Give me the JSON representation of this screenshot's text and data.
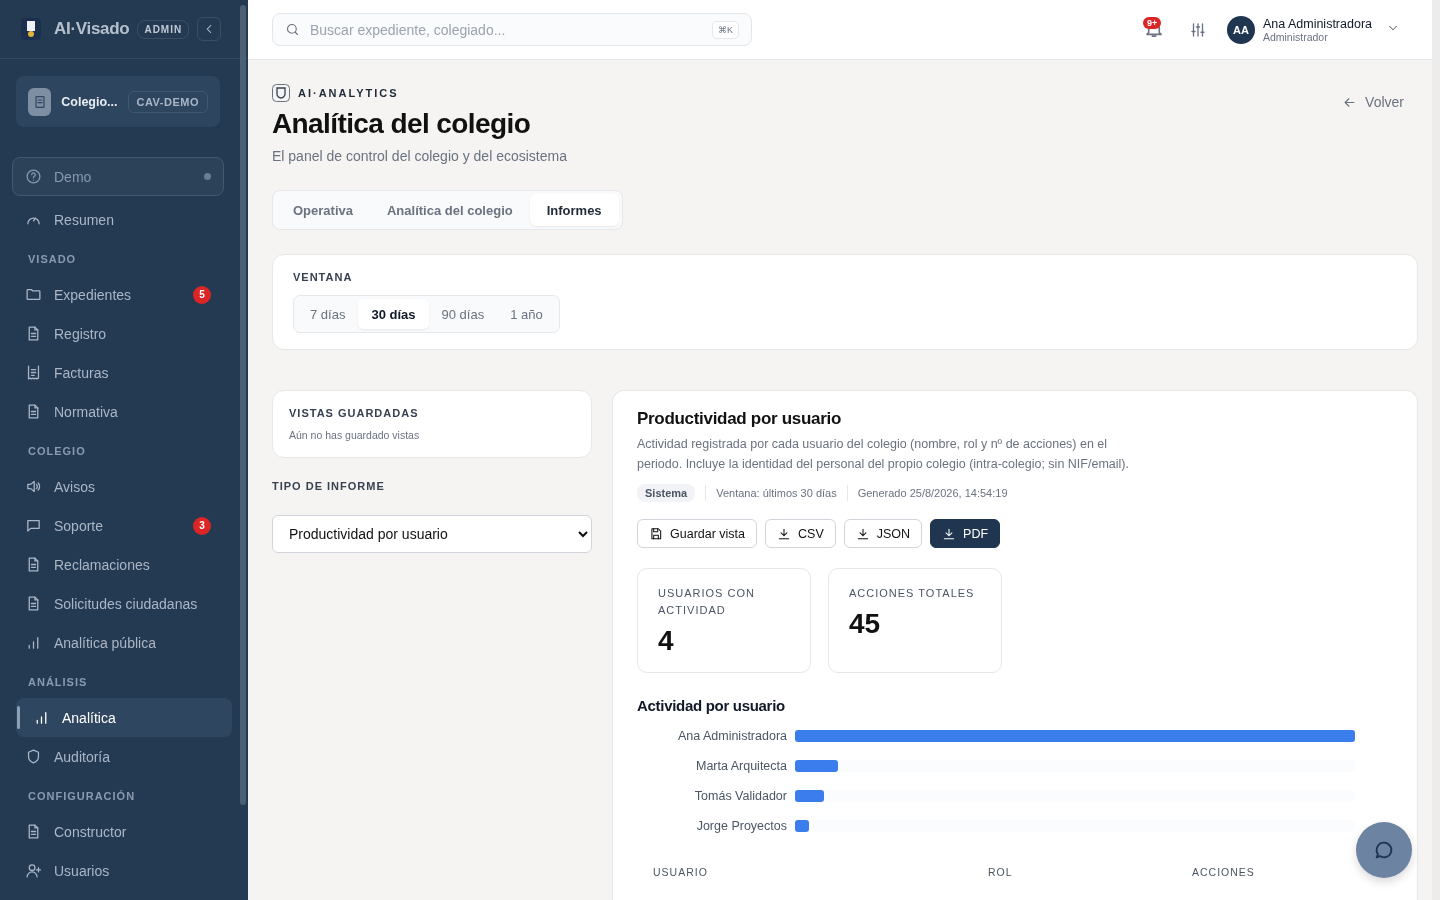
{
  "brand": {
    "name": "AI·Visado",
    "role_badge": "ADMIN"
  },
  "org": {
    "name": "Colegio...",
    "code": "CAV-DEMO"
  },
  "sidebar": {
    "top_items": [
      {
        "label": "Demo",
        "kind": "demo",
        "selected": false
      },
      {
        "label": "Resumen",
        "kind": "link",
        "selected": false
      }
    ],
    "sections": [
      {
        "heading": "VISADO",
        "items": [
          {
            "label": "Expedientes",
            "badge": "5",
            "selected": false
          },
          {
            "label": "Registro",
            "selected": false
          },
          {
            "label": "Facturas",
            "selected": false
          },
          {
            "label": "Normativa",
            "selected": false
          }
        ]
      },
      {
        "heading": "COLEGIO",
        "items": [
          {
            "label": "Avisos",
            "selected": false
          },
          {
            "label": "Soporte",
            "badge": "3",
            "selected": false
          },
          {
            "label": "Reclamaciones",
            "selected": false
          },
          {
            "label": "Solicitudes ciudadanas",
            "selected": false
          },
          {
            "label": "Analítica pública",
            "selected": false
          }
        ]
      },
      {
        "heading": "ANÁLISIS",
        "items": [
          {
            "label": "Analítica",
            "selected": true
          },
          {
            "label": "Auditoría",
            "selected": false
          }
        ]
      },
      {
        "heading": "CONFIGURACIÓN",
        "items": [
          {
            "label": "Constructor",
            "selected": false
          },
          {
            "label": "Usuarios",
            "selected": false
          }
        ]
      }
    ]
  },
  "topbar": {
    "search": {
      "placeholder": "Buscar expediente, colegiado...",
      "shortcut": "⌘K"
    },
    "notifications_badge": "9+",
    "user": {
      "initials": "AA",
      "name": "Ana Administradora",
      "role": "Administrador"
    }
  },
  "header": {
    "eyebrow": "AI·ANALYTICS",
    "title": "Analítica del colegio",
    "subtitle": "El panel de control del colegio y del ecosistema",
    "back": "Volver"
  },
  "tabs": [
    {
      "label": "Operativa",
      "selected": false
    },
    {
      "label": "Analítica del colegio",
      "selected": false
    },
    {
      "label": "Informes",
      "selected": true
    }
  ],
  "window": {
    "label": "VENTANA",
    "options": [
      {
        "label": "7 días",
        "selected": false
      },
      {
        "label": "30 días",
        "selected": true
      },
      {
        "label": "90 días",
        "selected": false
      },
      {
        "label": "1 año",
        "selected": false
      }
    ]
  },
  "saved_views": {
    "title": "VISTAS GUARDADAS",
    "empty": "Aún no has guardado vistas"
  },
  "report_type": {
    "label": "TIPO DE INFORME",
    "value": "Productividad por usuario"
  },
  "report": {
    "title": "Productividad por usuario",
    "description": "Actividad registrada por cada usuario del colegio (nombre, rol y nº de acciones) en el periodo. Incluye la identidad del personal del propio colegio (intra-colegio; sin NIF/email).",
    "source": "Sistema",
    "window_text": "Ventana: últimos 30 días",
    "generated": "Generado 25/8/2026, 14:54:19",
    "actions": [
      {
        "label": "Guardar vista",
        "kind": "save",
        "primary": false
      },
      {
        "label": "CSV",
        "kind": "download",
        "primary": false
      },
      {
        "label": "JSON",
        "kind": "download",
        "primary": false
      },
      {
        "label": "PDF",
        "kind": "download",
        "primary": true
      }
    ],
    "stats": [
      {
        "label": "USUARIOS CON ACTIVIDAD",
        "value": "4"
      },
      {
        "label": "ACCIONES TOTALES",
        "value": "45"
      }
    ],
    "chart": {
      "title": "Actividad por usuario",
      "bars": [
        {
          "name": "Ana Administradora",
          "level": 1
        },
        {
          "name": "Marta Arquitecta",
          "level": 0.077
        },
        {
          "name": "Tomás Validador",
          "level": 0.052
        },
        {
          "name": "Jorge Proyectos",
          "level": 0.025
        }
      ]
    },
    "table": {
      "columns": [
        "USUARIO",
        "ROL",
        "ACCIONES"
      ]
    }
  }
}
